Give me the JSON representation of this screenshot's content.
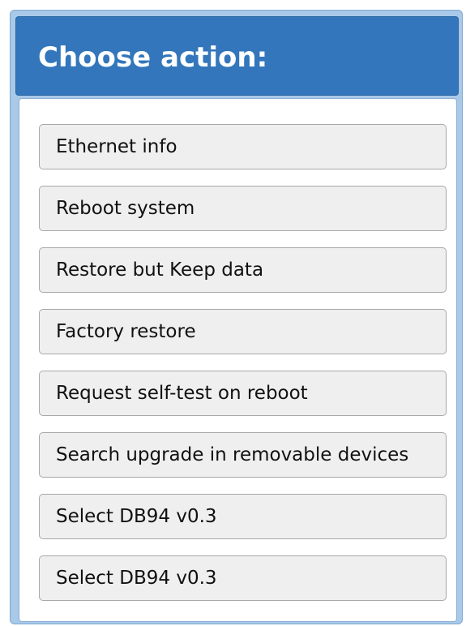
{
  "dialog": {
    "title": "Choose action:",
    "actions": [
      {
        "label": "Ethernet info"
      },
      {
        "label": "Reboot system"
      },
      {
        "label": "Restore but Keep data"
      },
      {
        "label": "Factory restore"
      },
      {
        "label": "Request self-test on reboot"
      },
      {
        "label": "Search upgrade in removable devices"
      },
      {
        "label": "Select DB94 v0.3"
      },
      {
        "label": "Select DB94 v0.3"
      }
    ]
  },
  "colors": {
    "title_bar": "#3376bb",
    "dialog_frame": "#a9c9e8",
    "button_background": "#efefef"
  }
}
